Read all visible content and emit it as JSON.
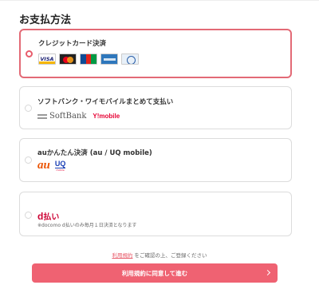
{
  "page": {
    "title": "お支払方法"
  },
  "options": [
    {
      "label": "クレジットカード決済",
      "selected": true,
      "cards": [
        {
          "name": "visa",
          "text": "VISA"
        },
        {
          "name": "mastercard"
        },
        {
          "name": "jcb"
        },
        {
          "name": "amex"
        },
        {
          "name": "diners"
        }
      ]
    },
    {
      "label": "ソフトバンク・ワイモバイルまとめて支払い",
      "selected": false,
      "brand_softbank": "SoftBank",
      "brand_ymobile": "Y!mobile"
    },
    {
      "label": "auかんたん決済 (au / UQ mobile)",
      "selected": false,
      "brand_au": "au",
      "brand_uq": "UQ",
      "brand_uq_sub": "mobile"
    },
    {
      "label": "払い",
      "brand_d": "d",
      "selected": false,
      "note": "※docomo d払いのみ毎月１日決済となります"
    }
  ],
  "terms": {
    "link_text": "利用規約",
    "suffix": "をご確認の上、ご登録ください"
  },
  "submit": {
    "label": "利用規約に同意して進む"
  },
  "colors": {
    "accent": "#ef6272",
    "selected_border": "#e36a76"
  }
}
